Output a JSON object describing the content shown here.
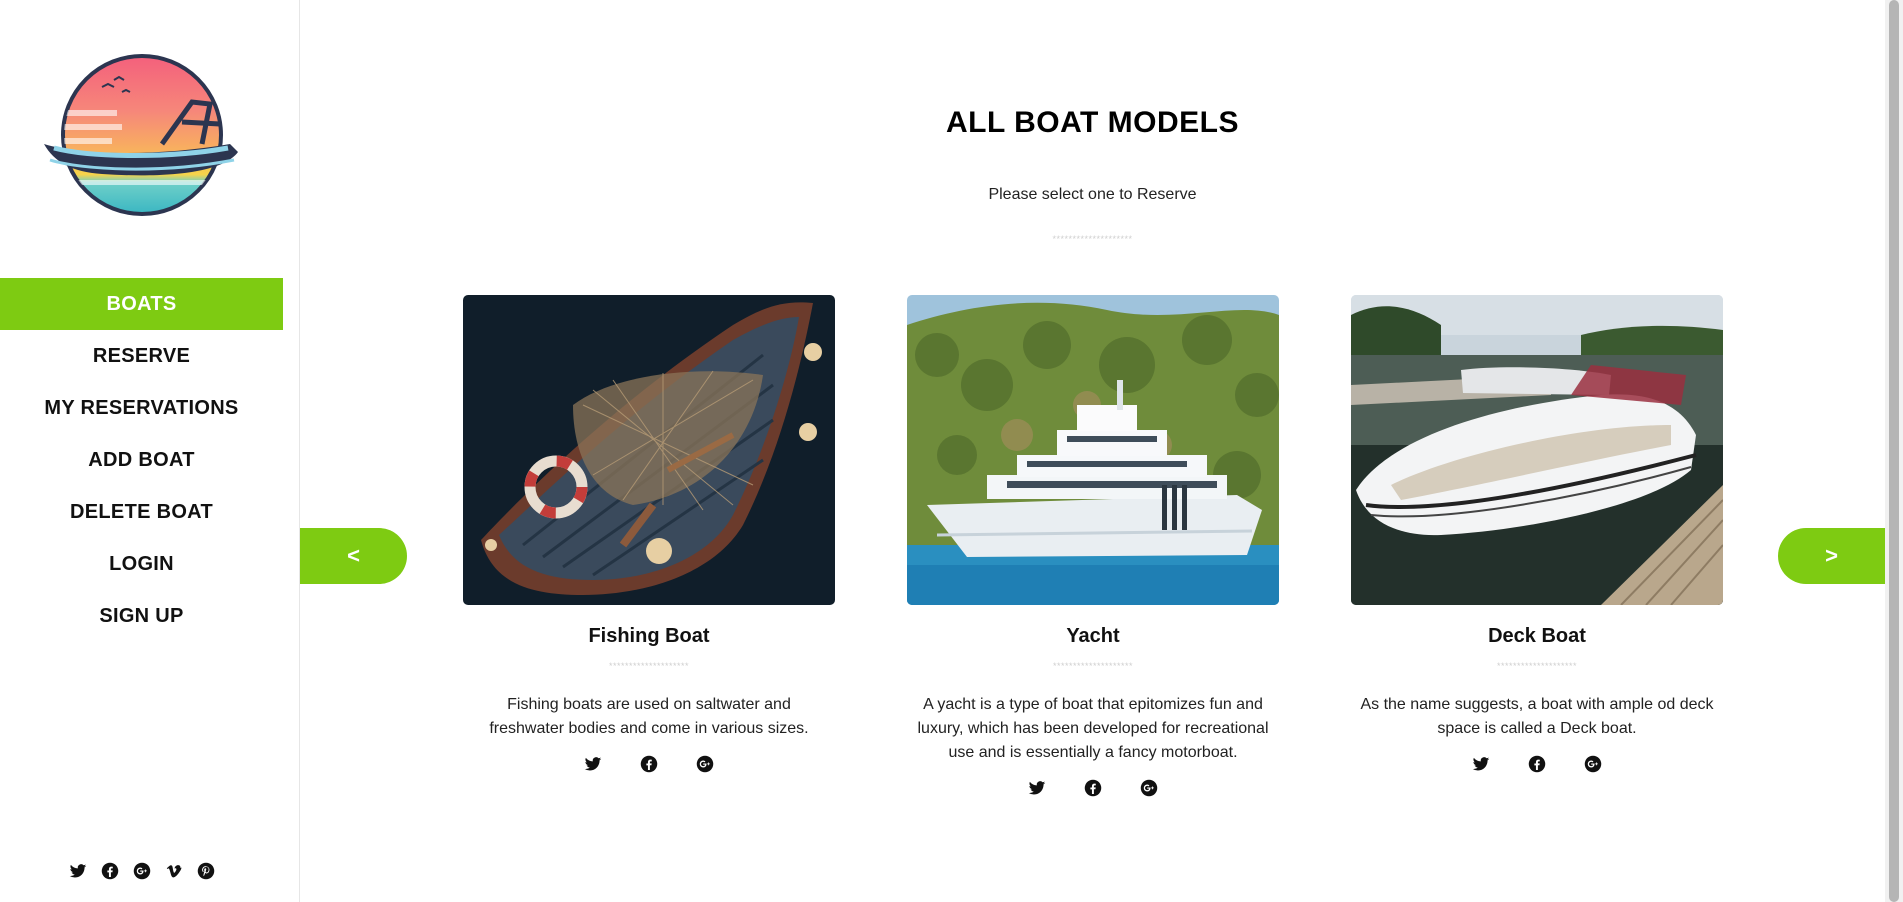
{
  "sidebar": {
    "logo": "boat-sunset-logo",
    "items": [
      {
        "label": "BOATS",
        "active": true
      },
      {
        "label": "RESERVE",
        "active": false
      },
      {
        "label": "MY RESERVATIONS",
        "active": false
      },
      {
        "label": "ADD BOAT",
        "active": false
      },
      {
        "label": "DELETE BOAT",
        "active": false
      },
      {
        "label": "LOGIN",
        "active": false
      },
      {
        "label": "SIGN UP",
        "active": false
      }
    ],
    "social": [
      "twitter-icon",
      "facebook-icon",
      "google-plus-icon",
      "vimeo-icon",
      "pinterest-icon"
    ]
  },
  "main": {
    "title": "ALL BOAT MODELS",
    "subtitle": "Please select one to Reserve",
    "dots": "********************",
    "prev_label": "<",
    "next_label": ">",
    "cards": [
      {
        "title": "Fishing Boat",
        "description": "Fishing boats are used on saltwater and freshwater bodies and come in various sizes.",
        "social": [
          "twitter-icon",
          "facebook-icon",
          "google-plus-icon"
        ]
      },
      {
        "title": "Yacht",
        "description": "A yacht is a type of boat that epitomizes fun and luxury, which has been developed for recreational use and is essentially a fancy motorboat.",
        "social": [
          "twitter-icon",
          "facebook-icon",
          "google-plus-icon"
        ]
      },
      {
        "title": "Deck Boat",
        "description": "As the name suggests, a boat with ample od deck space is called a Deck boat.",
        "social": [
          "twitter-icon",
          "facebook-icon",
          "google-plus-icon"
        ]
      }
    ]
  },
  "colors": {
    "accent": "#7ecb12",
    "text": "#111111",
    "dots": "#cfcfcf"
  }
}
